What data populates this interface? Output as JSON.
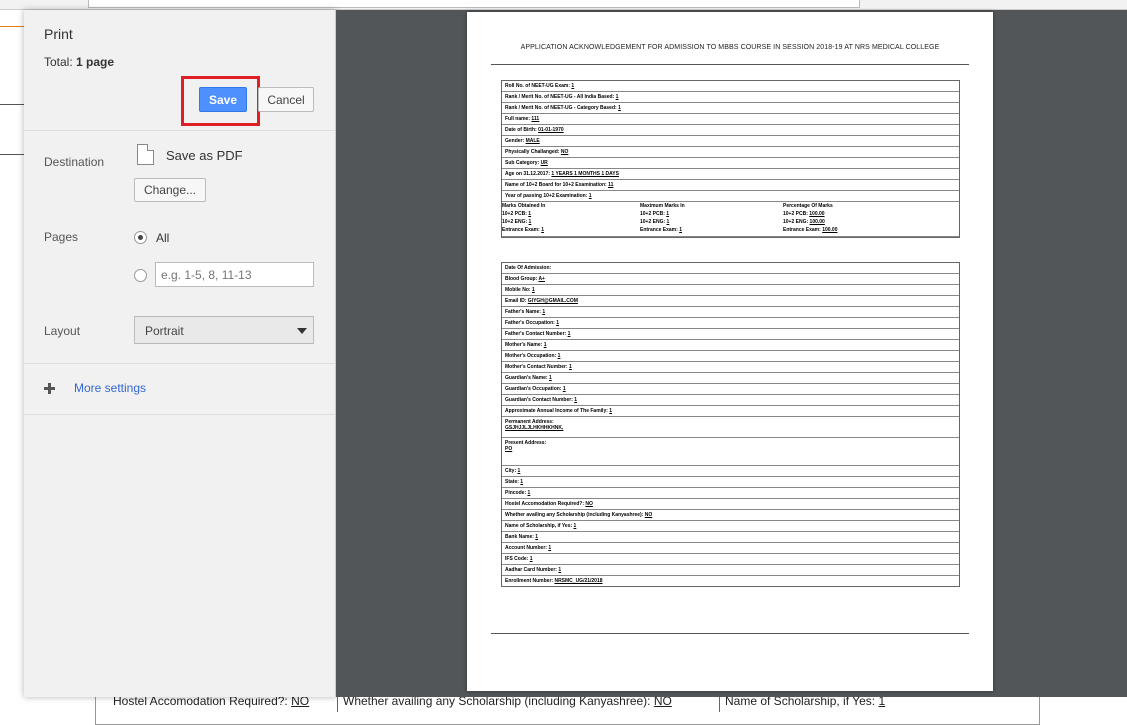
{
  "print_panel": {
    "title": "Print",
    "total_label": "Total:",
    "total_value": "1 page",
    "save_label": "Save",
    "cancel_label": "Cancel",
    "destination_label": "Destination",
    "destination_value": "Save as PDF",
    "change_label": "Change...",
    "pages_label": "Pages",
    "pages_all": "All",
    "pages_placeholder": "e.g. 1-5, 8, 11-13",
    "layout_label": "Layout",
    "layout_value": "Portrait",
    "more_settings": "More settings",
    "highlight_color": "#e01e26",
    "accent_color": "#4d90fe"
  },
  "preview": {
    "title": "APPLICATION ACKNOWLEDGEMENT FOR ADMISSION TO MBBS COURSE IN SESSION 2018-19 AT NRS MEDICAL COLLEGE",
    "section1": [
      {
        "k": "Roll No. of NEET-UG Exam:",
        "v": "1"
      },
      {
        "k": "Rank / Merit No. of NEET-UG - All India Based:",
        "v": "1"
      },
      {
        "k": "Rank / Merit No. of NEET-UG - Category Based:",
        "v": "1"
      },
      {
        "k": "Full name:",
        "v": "111"
      },
      {
        "k": "Date of Birth:",
        "v": "01-01-1970"
      },
      {
        "k": "Gender:",
        "v": "MALE"
      },
      {
        "k": "Physically Challanged:",
        "v": "NO"
      },
      {
        "k": "Sub Category:",
        "v": "UR"
      },
      {
        "k": "Age on 31.12.2017:",
        "v": "1 YEARS 1 MONTHS 1 DAYS"
      },
      {
        "k": "Name of 10+2 Board for 10+2 Examination:",
        "v": "11"
      },
      {
        "k": "Year of passing 10+2 Examination:",
        "v": "1"
      }
    ],
    "marks": {
      "headers": [
        "Marks Obtained In",
        "Maximum Marks In",
        "Percentage Of Marks"
      ],
      "rows": [
        [
          "10+2 PCB:",
          "1",
          "10+2 PCB:",
          "1",
          "10+2 PCB:",
          "100.00"
        ],
        [
          "10+2 ENG:",
          "1",
          "10+2 ENG:",
          "1",
          "10+2 ENG:",
          "100.00"
        ],
        [
          "Entrance Exam:",
          "1",
          "Entrance Exam:",
          "1",
          "Entrance Exam:",
          "100.00"
        ]
      ]
    },
    "section2": [
      {
        "k": "Date Of Admission:",
        "v": ""
      },
      {
        "k": "Blood Group:",
        "v": "A+"
      },
      {
        "k": "Mobile No:",
        "v": "1"
      },
      {
        "k": "Email ID:",
        "v": "GIYGH@GMAIL.COM"
      },
      {
        "k": "Father's Name:",
        "v": "1"
      },
      {
        "k": "Father's Occupation:",
        "v": "1"
      },
      {
        "k": "Father's Contact Number:",
        "v": "1"
      },
      {
        "k": "Mother's Name:",
        "v": "1"
      },
      {
        "k": "Mother's Occupation:",
        "v": "1"
      },
      {
        "k": "Mother's Contact Number:",
        "v": "1"
      },
      {
        "k": "Guardian's Name:",
        "v": "1"
      },
      {
        "k": "Guardian's Occupation:",
        "v": "1"
      },
      {
        "k": "Guardian's Contact Number:",
        "v": "1"
      },
      {
        "k": "Approximate Annual Income of The Family:",
        "v": "1"
      },
      {
        "k": "Permanent Address:",
        "v": "GSJHJJLJLHKHHKHNK,",
        "multi": true
      },
      {
        "k": "Present Address:",
        "v": "PO",
        "multi": true
      },
      {
        "k": "City:",
        "v": "1"
      },
      {
        "k": "State:",
        "v": "1"
      },
      {
        "k": "Pincode:",
        "v": "1"
      },
      {
        "k": "Hostel Accomodation Required?:",
        "v": "NO"
      },
      {
        "k": "Whether availing any Scholarship (including Kanyashree):",
        "v": "NO"
      },
      {
        "k": "Name of Scholarship, if Yes:",
        "v": "1"
      },
      {
        "k": "Bank Name:",
        "v": "1"
      },
      {
        "k": "Account Number:",
        "v": "1"
      },
      {
        "k": "IFS Code:",
        "v": "1"
      },
      {
        "k": "Aadhar Card Number:",
        "v": "1"
      },
      {
        "k": "Enrollment Number:",
        "v": "NRSMC_UG/21/2018"
      }
    ]
  },
  "background_row": {
    "c1_label": "Hostel Accomodation Required?:",
    "c1_value": "NO",
    "c2_label": "Whether availing any Scholarship (including Kanyashree):",
    "c2_value": "NO",
    "c3_label": "Name of Scholarship, if Yes:",
    "c3_value": "1"
  }
}
